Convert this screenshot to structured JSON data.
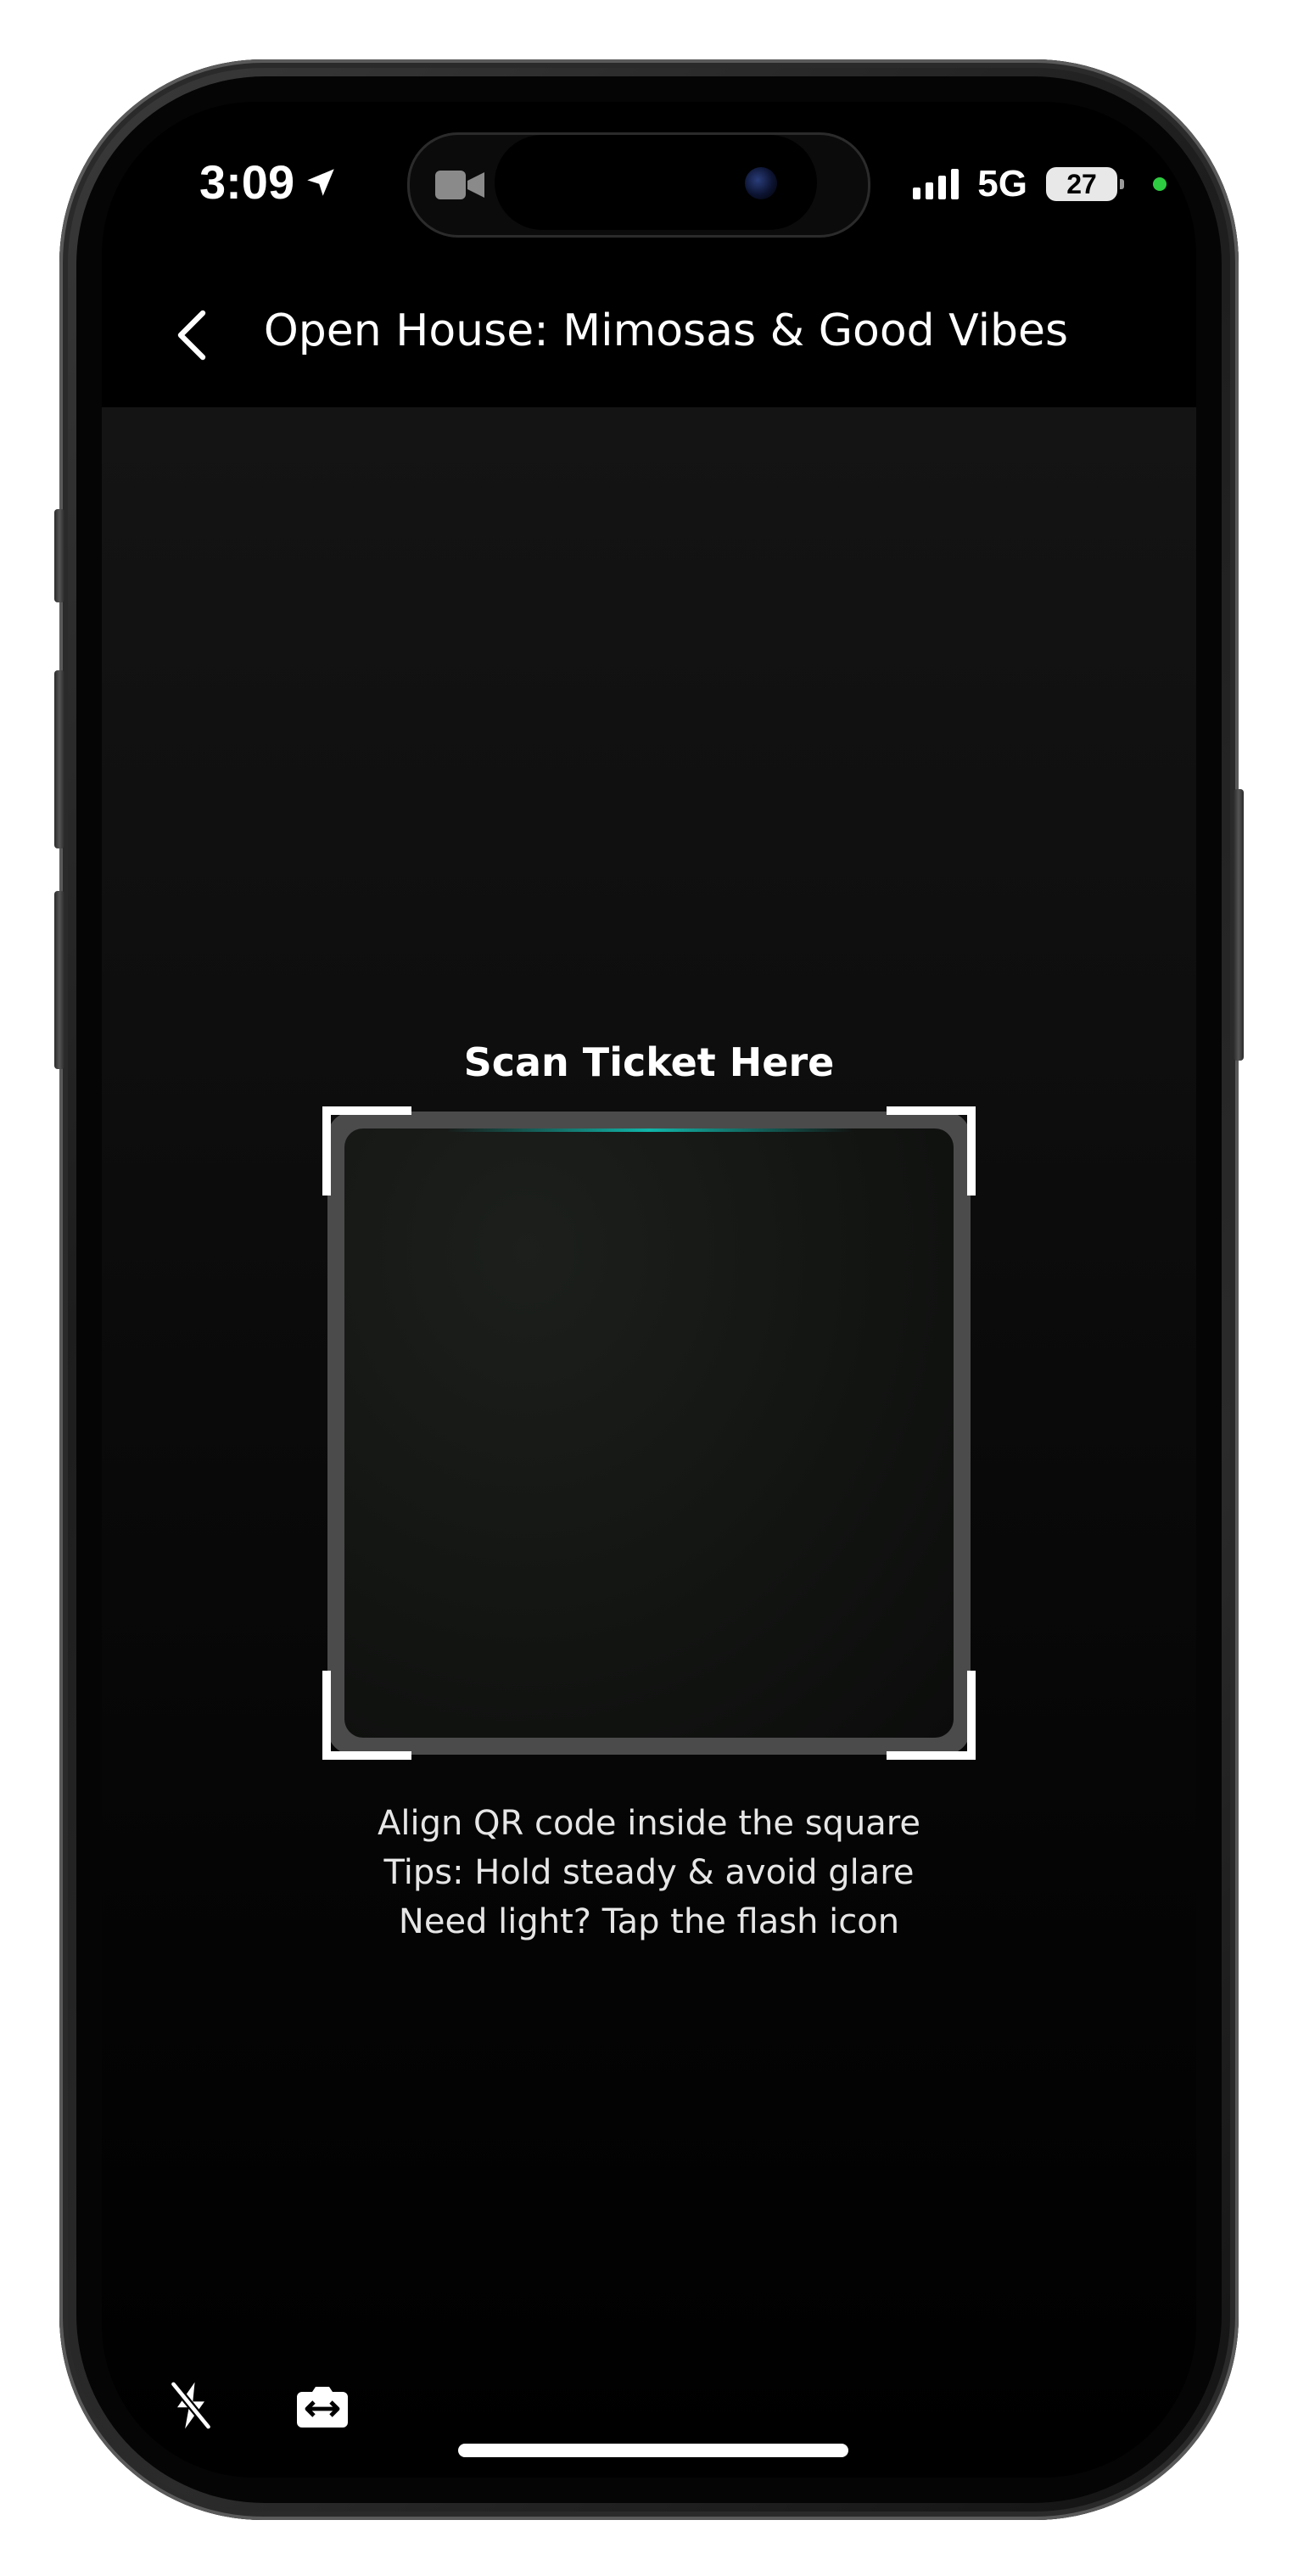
{
  "status_bar": {
    "time": "3:09",
    "network": "5G",
    "battery": "27"
  },
  "header": {
    "title": "Open House: Mimosas & Good Vibes",
    "back_icon": "chevron-left-icon"
  },
  "scanner": {
    "title": "Scan Ticket Here",
    "tips": [
      "Align QR code inside the square",
      "Tips: Hold steady & avoid glare",
      "Need light? Tap the flash icon"
    ],
    "accent_color": "#10b6aa"
  },
  "controls": {
    "flash_icon": "flash-off-icon",
    "switch_camera_icon": "switch-camera-icon"
  }
}
